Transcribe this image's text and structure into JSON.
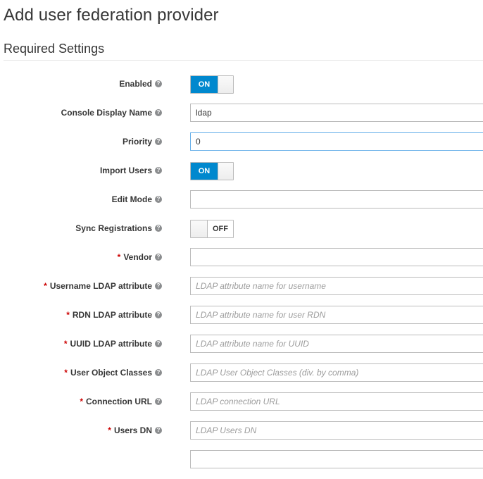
{
  "page": {
    "title": "Add user federation provider"
  },
  "section": {
    "title": "Required Settings"
  },
  "fields": {
    "enabled": {
      "label": "Enabled",
      "state": "ON"
    },
    "console_display_name": {
      "label": "Console Display Name",
      "value": "ldap"
    },
    "priority": {
      "label": "Priority",
      "value": "0"
    },
    "import_users": {
      "label": "Import Users",
      "state": "ON"
    },
    "edit_mode": {
      "label": "Edit Mode",
      "value": ""
    },
    "sync_registrations": {
      "label": "Sync Registrations",
      "state": "OFF"
    },
    "vendor": {
      "label": "Vendor",
      "value": ""
    },
    "username_ldap_attribute": {
      "label": "Username LDAP attribute",
      "placeholder": "LDAP attribute name for username"
    },
    "rdn_ldap_attribute": {
      "label": "RDN LDAP attribute",
      "placeholder": "LDAP attribute name for user RDN"
    },
    "uuid_ldap_attribute": {
      "label": "UUID LDAP attribute",
      "placeholder": "LDAP attribute name for UUID"
    },
    "user_object_classes": {
      "label": "User Object Classes",
      "placeholder": "LDAP User Object Classes (div. by comma)"
    },
    "connection_url": {
      "label": "Connection URL",
      "placeholder": "LDAP connection URL"
    },
    "users_dn": {
      "label": "Users DN",
      "placeholder": "LDAP Users DN"
    }
  },
  "required_marker": "*",
  "help_icon_glyph": "?"
}
